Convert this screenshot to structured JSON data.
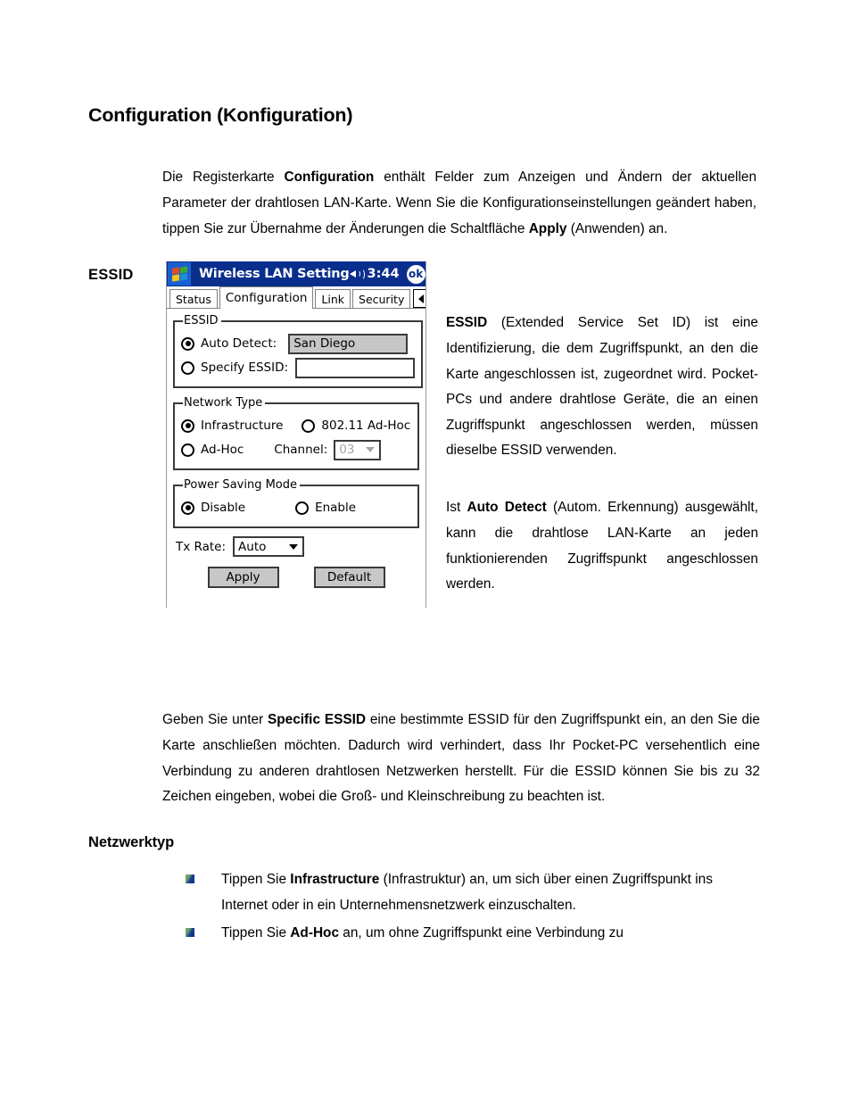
{
  "document": {
    "heading": "Configuration (Konfiguration)",
    "sub_heading": "Netzwerktyp",
    "margin_label": "ESSID",
    "intro_paragraph": {
      "part1": "Die Registerkarte ",
      "bold1": "Configuration",
      "part2": " enthält Felder zum Anzeigen und Ändern der aktuellen Parameter der drahtlosen LAN-Karte. Wenn Sie die Konfigurationseinstellungen geändert haben, tippen Sie zur Übernahme der Änderungen die Schaltfläche ",
      "bold2": "Apply",
      "part3": " (Anwenden) an."
    },
    "essid_description": {
      "bold1": "ESSID",
      "part1": " (Extended Service Set ID) ist eine Identifizierung, die dem Zugriffspunkt, an den die Karte angeschlossen ist, zugeordnet wird. Pocket-PCs und andere drahtlose Geräte, die an einen Zugriffspunkt angeschlossen werden, müssen dieselbe ESSID verwenden."
    },
    "auto_detect_description": {
      "part1": "Ist ",
      "bold1": "Auto Detect",
      "part2": " (Autom. Erkennung) ausgewählt, kann die drahtlose LAN-Karte an jeden funktionierenden Zugriffspunkt angeschlossen werden."
    },
    "specific_essid_paragraph": {
      "part1": "Geben Sie unter ",
      "bold1": "Specific ESSID",
      "part2": " eine bestimmte ESSID für den Zugriffspunkt ein, an den Sie die Karte anschließen möchten. Dadurch wird verhindert, dass Ihr Pocket-PC versehentlich eine Verbindung zu anderen drahtlosen Netzwerken herstellt. Für die ESSID können Sie bis zu 32 Zeichen eingeben, wobei die Groß- und Kleinschreibung zu beachten ist."
    },
    "bullets": [
      {
        "icon": "green-blue-square-bullet-icon",
        "part1": "Tippen Sie ",
        "bold1": "Infrastructure",
        "part2": " (Infrastruktur) an, um sich über einen Zugriffspunkt ins Internet oder in ein Unternehmensnetzwerk einzuschalten."
      },
      {
        "icon": "green-blue-square-bullet-icon",
        "part1": "Tippen Sie ",
        "bold1": "Ad-Hoc",
        "part2": " an, um ohne Zugriffspunkt eine Verbindung zu"
      }
    ]
  },
  "device_screenshot": {
    "title_bar": {
      "start_icon": "windows-flag-icon",
      "title": "Wireless LAN Setting",
      "volume_icon": "speaker-icon",
      "clock": "3:44",
      "ok_label": "ok"
    },
    "tabs": [
      {
        "label": "Status",
        "active": false
      },
      {
        "label": "Configuration",
        "active": true
      },
      {
        "label": "Link",
        "active": false
      },
      {
        "label": "Security",
        "active": false
      }
    ],
    "tab_scroll": {
      "left_icon": "triangle-left-icon",
      "right_icon": "triangle-right-icon"
    },
    "essid_group": {
      "legend": "ESSID",
      "auto_detect": {
        "label": "Auto Detect:",
        "selected": true,
        "value": "San Diego"
      },
      "specify_essid": {
        "label": "Specify ESSID:",
        "selected": false,
        "value": "",
        "placeholder": ""
      }
    },
    "network_type_group": {
      "legend": "Network Type",
      "options": [
        {
          "label": "Infrastructure",
          "selected": true
        },
        {
          "label": "802.11 Ad-Hoc",
          "selected": false
        },
        {
          "label": "Ad-Hoc",
          "selected": false
        }
      ],
      "channel": {
        "label": "Channel:",
        "value": "03",
        "enabled": false
      }
    },
    "power_saving_group": {
      "legend": "Power Saving Mode",
      "options": [
        {
          "label": "Disable",
          "selected": true
        },
        {
          "label": "Enable",
          "selected": false
        }
      ]
    },
    "tx_rate": {
      "label": "Tx Rate:",
      "value": "Auto"
    },
    "buttons": {
      "apply": "Apply",
      "default": "Default"
    },
    "colors": {
      "title_bar": "#0a2e8c",
      "field_disabled": "#c7c7c7",
      "border": "#3a3a3a"
    }
  }
}
